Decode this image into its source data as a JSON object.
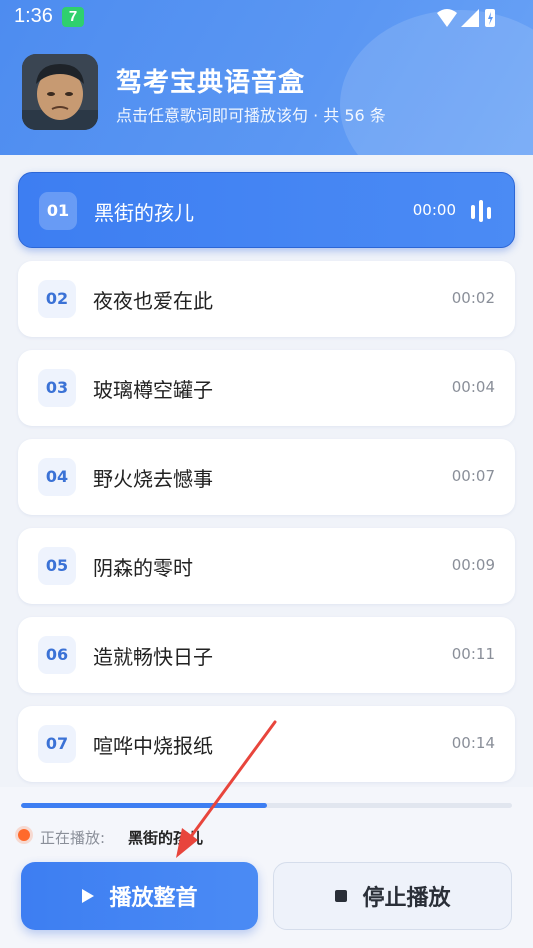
{
  "status_bar": {
    "time": "1:36",
    "badge": "7",
    "icons": [
      "wifi-icon",
      "signal-icon",
      "battery-icon"
    ]
  },
  "header": {
    "title": "驾考宝典语音盒",
    "subtitle": "点击任意歌词即可播放该句 · 共 56 条"
  },
  "tracks": [
    {
      "num": "01",
      "title": "黑街的孩儿",
      "time": "00:00",
      "active": true
    },
    {
      "num": "02",
      "title": "夜夜也爱在此",
      "time": "00:02"
    },
    {
      "num": "03",
      "title": "玻璃樽空罐子",
      "time": "00:04"
    },
    {
      "num": "04",
      "title": "野火烧去憾事",
      "time": "00:07"
    },
    {
      "num": "05",
      "title": "阴森的零时",
      "time": "00:09"
    },
    {
      "num": "06",
      "title": "造就畅快日子",
      "time": "00:11"
    },
    {
      "num": "07",
      "title": "喧哗中烧报纸",
      "time": "00:14"
    }
  ],
  "player": {
    "progress": 0.5,
    "now_playing_label": "正在播放:",
    "now_playing_track": "黑街的孩儿",
    "play_label": "播放整首",
    "stop_label": "停止播放"
  },
  "colors": {
    "accent": "#3d7ef2",
    "header": "#5b97f3",
    "indicator": "#ff6a2b",
    "annotation_arrow": "#e8453c"
  }
}
